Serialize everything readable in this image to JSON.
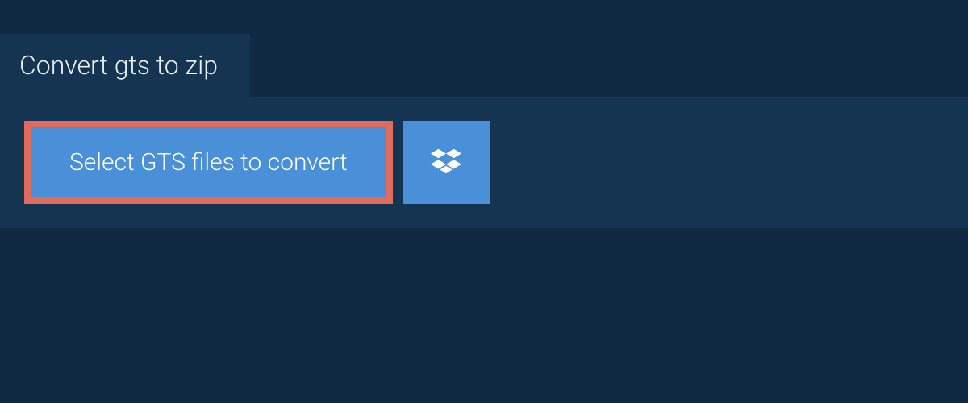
{
  "tab": {
    "label": "Convert gts to zip"
  },
  "actions": {
    "select_files_label": "Select GTS files to convert",
    "dropbox_icon": "dropbox-icon"
  },
  "colors": {
    "background": "#0f2942",
    "panel": "#143452",
    "button_bg": "#4a90d9",
    "highlight_border": "#e06b5c",
    "text_light": "#e8eef4"
  }
}
